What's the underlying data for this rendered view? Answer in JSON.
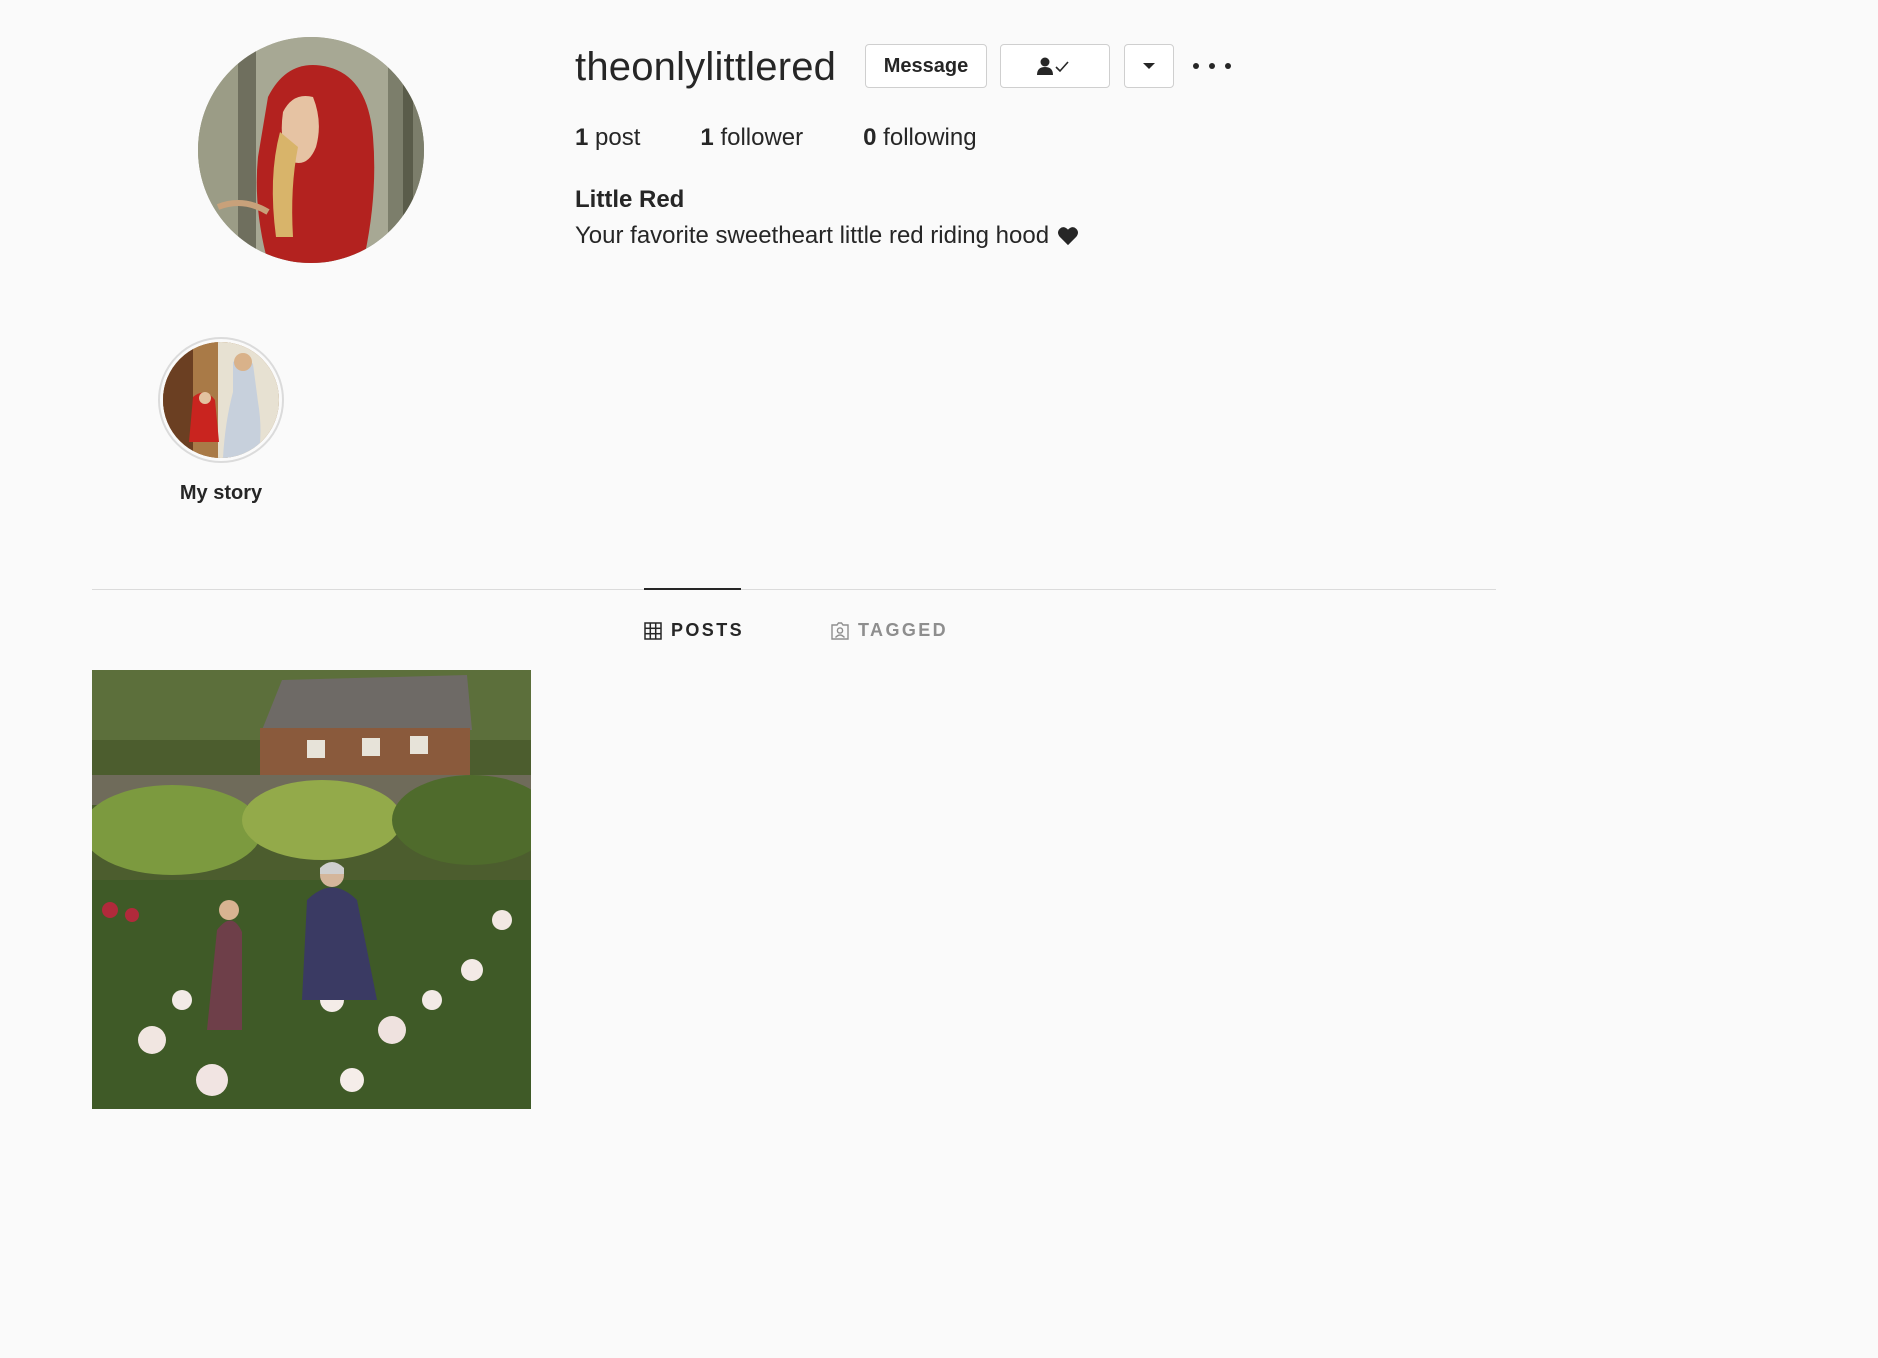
{
  "profile": {
    "username": "theonlylittlered",
    "full_name": "Little Red",
    "bio": "Your favorite sweetheart little red riding hood"
  },
  "actions": {
    "message_label": "Message"
  },
  "stats": {
    "posts_count": "1",
    "posts_label": "post",
    "followers_count": "1",
    "followers_label": "follower",
    "following_count": "0",
    "following_label": "following"
  },
  "highlights": [
    {
      "label": "My story"
    }
  ],
  "tabs": [
    {
      "label": "POSTS",
      "active": true
    },
    {
      "label": "TAGGED",
      "active": false
    }
  ],
  "icons": {
    "following": "person-check-icon",
    "dropdown": "chevron-down-icon",
    "more": "more-options-icon",
    "posts_tab": "grid-icon",
    "tagged_tab": "tag-user-icon",
    "bio_emoji": "heart-icon"
  },
  "colors": {
    "background": "#fafafa",
    "text": "#262626",
    "muted": "#8e8e8e",
    "border": "#dbdbdb"
  }
}
